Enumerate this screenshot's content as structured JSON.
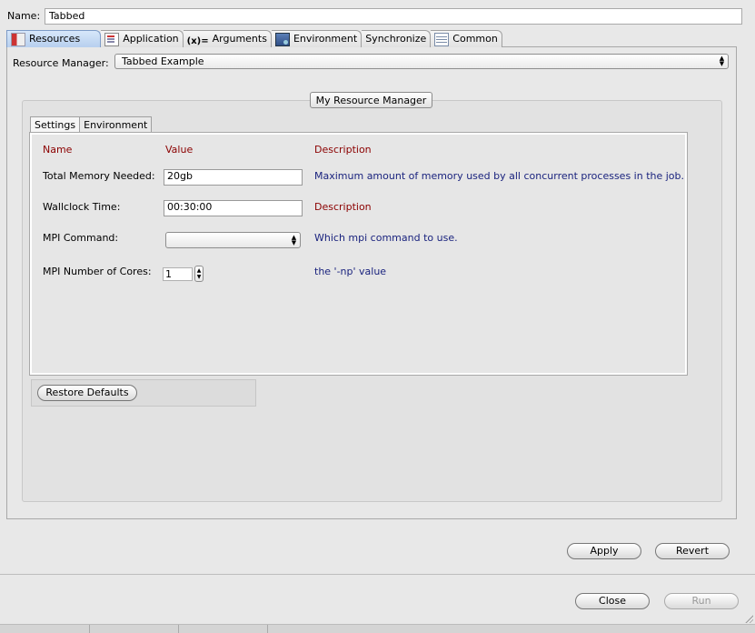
{
  "name": {
    "label": "Name:",
    "value": "Tabbed"
  },
  "tabs": [
    {
      "label": "Resources",
      "icon": "resources-icon",
      "selected": true
    },
    {
      "label": "Application",
      "icon": "application-icon",
      "selected": false
    },
    {
      "label": "Arguments",
      "icon_text": "(x)=",
      "icon": "arguments-icon",
      "selected": false
    },
    {
      "label": "Environment",
      "icon": "environment-icon",
      "selected": false
    },
    {
      "label": "Synchronize",
      "icon": "",
      "selected": false
    },
    {
      "label": "Common",
      "icon": "common-icon",
      "selected": false
    }
  ],
  "resource_manager": {
    "label": "Resource Manager:",
    "value": "Tabbed Example"
  },
  "group": {
    "title": "My Resource Manager",
    "tabs": [
      {
        "label": "Settings",
        "selected": true
      },
      {
        "label": "Environment",
        "selected": false
      }
    ],
    "headers": {
      "name": "Name",
      "value": "Value",
      "description": "Description"
    },
    "rows": [
      {
        "label": "Total Memory Needed:",
        "value": "20gb",
        "description": "Maximum amount of memory used by all concurrent processes in the job."
      },
      {
        "label": "Wallclock Time:",
        "value": "00:30:00",
        "description": "Description"
      },
      {
        "label": "MPI Command:",
        "value": "",
        "description": "Which mpi command to use."
      },
      {
        "label": "MPI Number of Cores:",
        "value": "1",
        "description": "the '-np' value"
      }
    ],
    "restore_defaults": "Restore Defaults"
  },
  "buttons": {
    "apply": "Apply",
    "revert": "Revert",
    "close": "Close",
    "run": "Run"
  },
  "colors": {
    "header_red": "#8b0000",
    "description_blue": "#1a237e",
    "selected_tab": "#b7cfee"
  }
}
